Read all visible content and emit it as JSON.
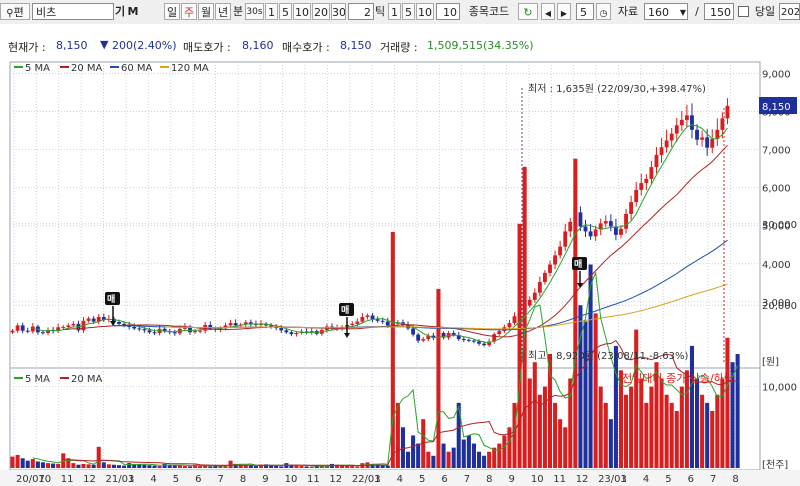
{
  "toolbar": {
    "search_icon": "magnifier-icon",
    "search_prefix": "편",
    "stock_name": "비츠",
    "code_marker": "기",
    "memo_marker": "M",
    "period_day": "일",
    "period_week": "주",
    "period_month": "월",
    "period_year": "년",
    "minute_label": "분",
    "minute_value": "30s",
    "minute_presets": [
      "1",
      "5",
      "10",
      "20",
      "30"
    ],
    "tick_value": "2",
    "tick_label": "틱",
    "tick_presets": [
      "1",
      "5",
      "10"
    ],
    "tick_value2": "10",
    "code_label": "종목코드",
    "step_value": "5",
    "data_label": "자료",
    "data_count": "160",
    "slash": "/",
    "data_total": "150",
    "same_day_label": "당일",
    "date_value": "202"
  },
  "info": {
    "price_label": "현재가 :",
    "price": "8,150",
    "change": "200(2.40%)",
    "ask_label": "매도호가 :",
    "ask": "8,160",
    "bid_label": "매수호가 :",
    "bid": "8,150",
    "volume_label": "거래량 :",
    "volume": "1,509,515(34.35%)"
  },
  "colors": {
    "up": "#d81e1e",
    "down": "#1f2f9c",
    "ma5": "#2aa52a",
    "ma20": "#b22222",
    "ma60": "#1f4fb5",
    "ma120": "#e0a020",
    "grid": "#c9d2e0"
  },
  "chart_data": {
    "type": "candlestick",
    "price_axis": {
      "ticks": [
        "9,000",
        "8,000",
        "7,000",
        "6,000",
        "5,000",
        "4,000",
        "3,000"
      ],
      "unit": "[원]",
      "current": "8,150"
    },
    "volume_axis": {
      "ticks": [
        "30,000",
        "20,000",
        "10,000"
      ],
      "unit": "[천주]"
    },
    "x_ticks": [
      "20/07",
      "10",
      "11",
      "12",
      "21/01",
      "3",
      "4",
      "5",
      "6",
      "7",
      "8",
      "9",
      "10",
      "11",
      "12",
      "22/01",
      "3",
      "4",
      "5",
      "6",
      "7",
      "8",
      "9",
      "10",
      "11",
      "12",
      "23/01",
      "3",
      "4",
      "5",
      "6",
      "7",
      "8"
    ],
    "legend_price": [
      "5 MA",
      "20 MA",
      "60 MA",
      "120 MA"
    ],
    "legend_volume": [
      "5 MA",
      "20 MA"
    ],
    "max_label": "최저 : 1,635원 (22/09/30,+398.47%)",
    "min_label": "최고 : 8,920원 (23/08/11,-8.63%)",
    "volume_note": "전일대비 종가 상승/하락",
    "signal_markers": [
      "매",
      "매",
      "매"
    ],
    "close_series": [
      2240,
      2380,
      2240,
      2220,
      2350,
      2200,
      2180,
      2260,
      2230,
      2330,
      2340,
      2380,
      2420,
      2250,
      2500,
      2560,
      2480,
      2600,
      2520,
      2550,
      2470,
      2420,
      2390,
      2340,
      2300,
      2280,
      2250,
      2200,
      2180,
      2290,
      2230,
      2200,
      2170,
      2290,
      2350,
      2200,
      2230,
      2240,
      2390,
      2300,
      2270,
      2300,
      2380,
      2440,
      2380,
      2400,
      2460,
      2420,
      2390,
      2420,
      2380,
      2340,
      2310,
      2250,
      2200,
      2150,
      2180,
      2220,
      2200,
      2230,
      2160,
      2260,
      2350,
      2290,
      2310,
      2340,
      2390,
      2420,
      2480,
      2600,
      2640,
      2540,
      2500,
      2480,
      2380,
      2420,
      2460,
      2400,
      2300,
      2140,
      1980,
      2020,
      2110,
      2050,
      2180,
      2060,
      2180,
      2130,
      2020,
      2000,
      1980,
      1960,
      1900,
      1860,
      1955,
      2150,
      2230,
      2330,
      2440,
      2620,
      2750,
      2900,
      3050,
      3240,
      3520,
      3760,
      3980,
      4220,
      4450,
      4850,
      5100,
      5350,
      4980,
      4850,
      4720,
      4900,
      5060,
      5120,
      4980,
      4760,
      4920,
      5310,
      5620,
      5940,
      6120,
      6230,
      6540,
      6860,
      7060,
      7240,
      7420,
      7640,
      7780,
      7900,
      7520,
      7260,
      7320,
      7050,
      7280,
      7520,
      7820,
      8150
    ],
    "volume_series": [
      140,
      160,
      120,
      90,
      110,
      80,
      70,
      60,
      55,
      50,
      180,
      120,
      60,
      40,
      50,
      45,
      40,
      260,
      70,
      45,
      40,
      35,
      30,
      60,
      50,
      45,
      40,
      35,
      30,
      25,
      50,
      40,
      35,
      30,
      25,
      20,
      40,
      30,
      25,
      20,
      30,
      25,
      20,
      90,
      50,
      40,
      35,
      30,
      25,
      40,
      45,
      30,
      25,
      20,
      60,
      40,
      30,
      25,
      20,
      15,
      30,
      25,
      20,
      50,
      40,
      35,
      30,
      25,
      20,
      60,
      70,
      50,
      40,
      35,
      30,
      2900,
      800,
      500,
      200,
      400,
      300,
      600,
      200,
      150,
      2200,
      300,
      200,
      250,
      800,
      350,
      400,
      300,
      200,
      150,
      200,
      250,
      300,
      400,
      500,
      800,
      3000,
      3700,
      1100,
      1300,
      900,
      1000,
      1400,
      800,
      600,
      500,
      1100,
      3800,
      2000,
      1800,
      2500,
      1900,
      1000,
      800,
      600,
      1500,
      1200,
      900,
      1000,
      1700,
      1100,
      800,
      1000,
      1300,
      1100,
      900,
      800,
      700,
      1000,
      1200,
      1500,
      1100,
      900,
      800,
      700,
      900,
      1100,
      1600,
      1300,
      1400
    ]
  }
}
